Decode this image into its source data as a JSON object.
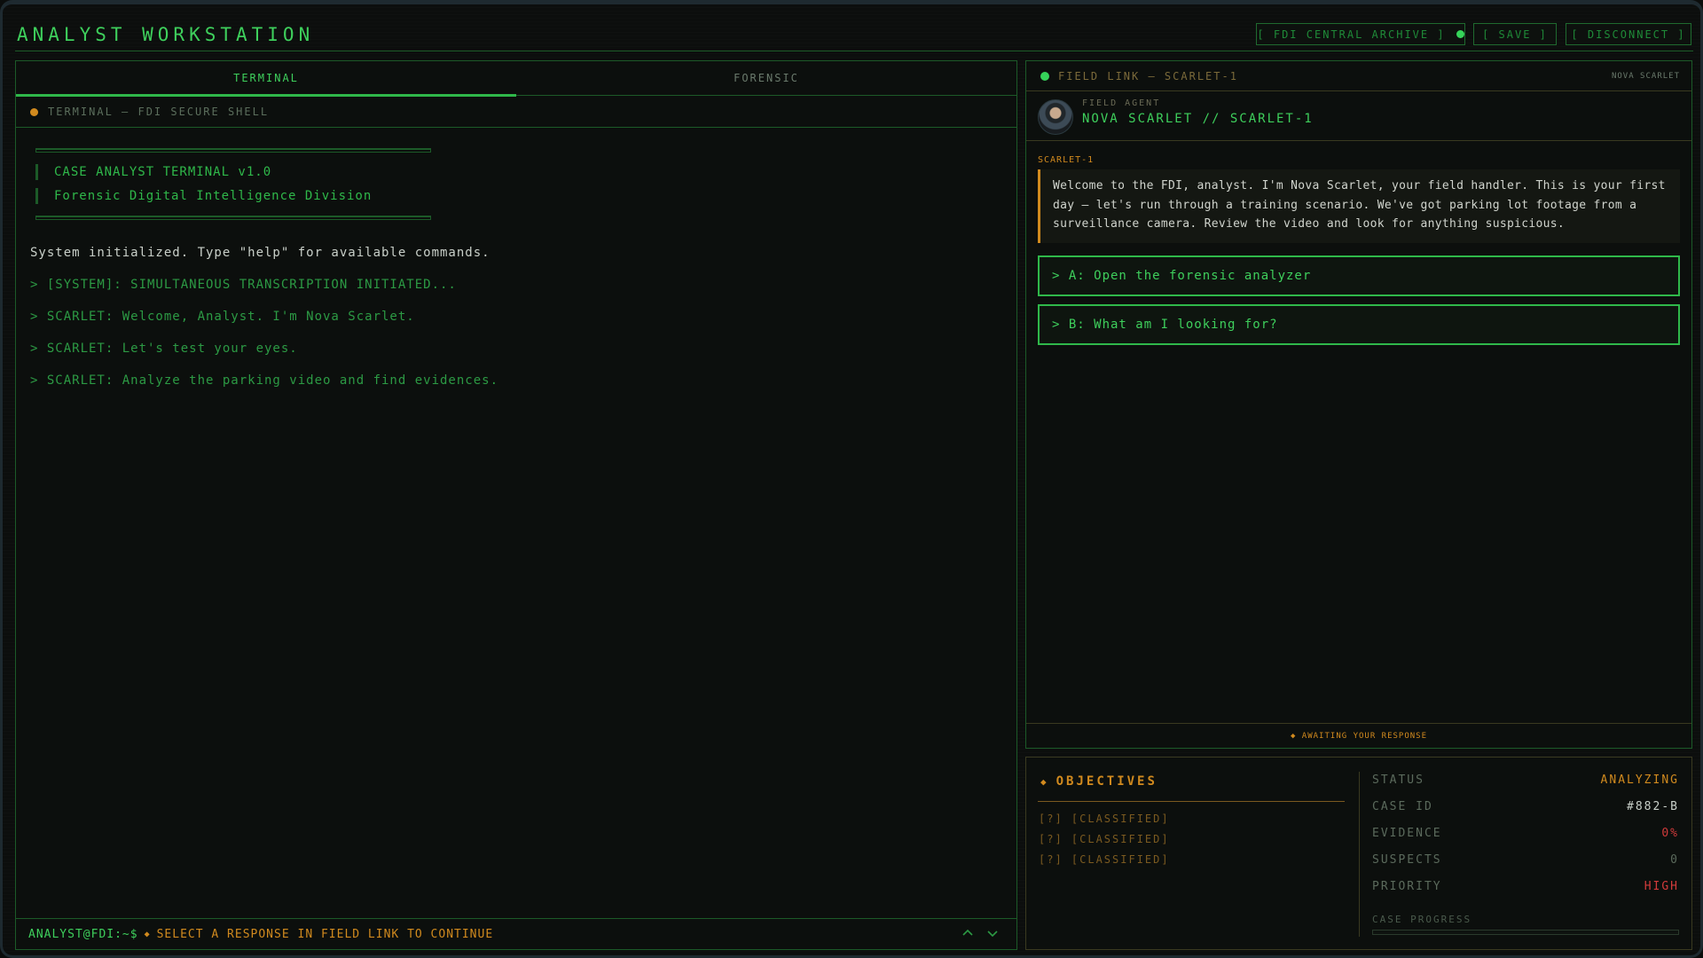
{
  "app": {
    "title": "ANALYST WORKSTATION"
  },
  "header": {
    "archive_label": "[ FDI CENTRAL ARCHIVE ]",
    "save_label": "[ SAVE ]",
    "disconnect_label": "[ DISCONNECT ]"
  },
  "tabs": [
    {
      "label": "TERMINAL",
      "active": true
    },
    {
      "label": "FORENSIC",
      "active": false
    }
  ],
  "terminal": {
    "header": "TERMINAL — FDI SECURE SHELL",
    "banner": [
      "CASE ANALYST TERMINAL v1.0",
      "Forensic Digital Intelligence Division"
    ],
    "system_message": "System initialized. Type \"help\" for available commands.",
    "lines": [
      "> [SYSTEM]: SIMULTANEOUS TRANSCRIPTION INITIATED...",
      "> SCARLET: Welcome, Analyst. I'm Nova Scarlet.",
      "> SCARLET: Let's test your eyes.",
      "> SCARLET: Analyze the parking video and find evidences."
    ],
    "prompt": "ANALYST@FDI:~$",
    "prompt_message": "SELECT A RESPONSE IN FIELD LINK TO CONTINUE"
  },
  "field_link": {
    "header": "FIELD LINK — SCARLET-1",
    "header_right": "NOVA SCARLET",
    "agent_label": "FIELD AGENT",
    "agent_name": "NOVA SCARLET // SCARLET-1",
    "speaker": "SCARLET-1",
    "message": "Welcome to the FDI, analyst. I'm Nova Scarlet, your field handler. This is your first day — let's run through a training scenario. We've got parking lot footage from a surveillance camera. Review the video and look for anything suspicious.",
    "choices": [
      {
        "label": "> A: Open the forensic analyzer"
      },
      {
        "label": "> B: What am I looking for?"
      }
    ],
    "status_footer": "◆ AWAITING YOUR RESPONSE"
  },
  "objectives": {
    "title": "OBJECTIVES",
    "items": [
      "[?] [CLASSIFIED]",
      "[?] [CLASSIFIED]",
      "[?] [CLASSIFIED]"
    ]
  },
  "case_stats": {
    "status_key": "STATUS",
    "status_value": "ANALYZING",
    "case_id_key": "CASE ID",
    "case_id_value": "#882-B",
    "evidence_key": "EVIDENCE",
    "evidence_value": "0%",
    "suspects_key": "SUSPECTS",
    "suspects_value": "0",
    "priority_key": "PRIORITY",
    "priority_value": "HIGH",
    "progress_label": "CASE PROGRESS",
    "progress_value": 0
  },
  "colors": {
    "accent_green": "#2fb84a",
    "accent_amber": "#d18a1e",
    "alert_red": "#d23b3b",
    "background": "#0c0e0d"
  },
  "icons": {
    "status_dot": "circle",
    "prompt_separator": "diamond",
    "nav_up": "chevron-up",
    "nav_down": "chevron-down"
  }
}
